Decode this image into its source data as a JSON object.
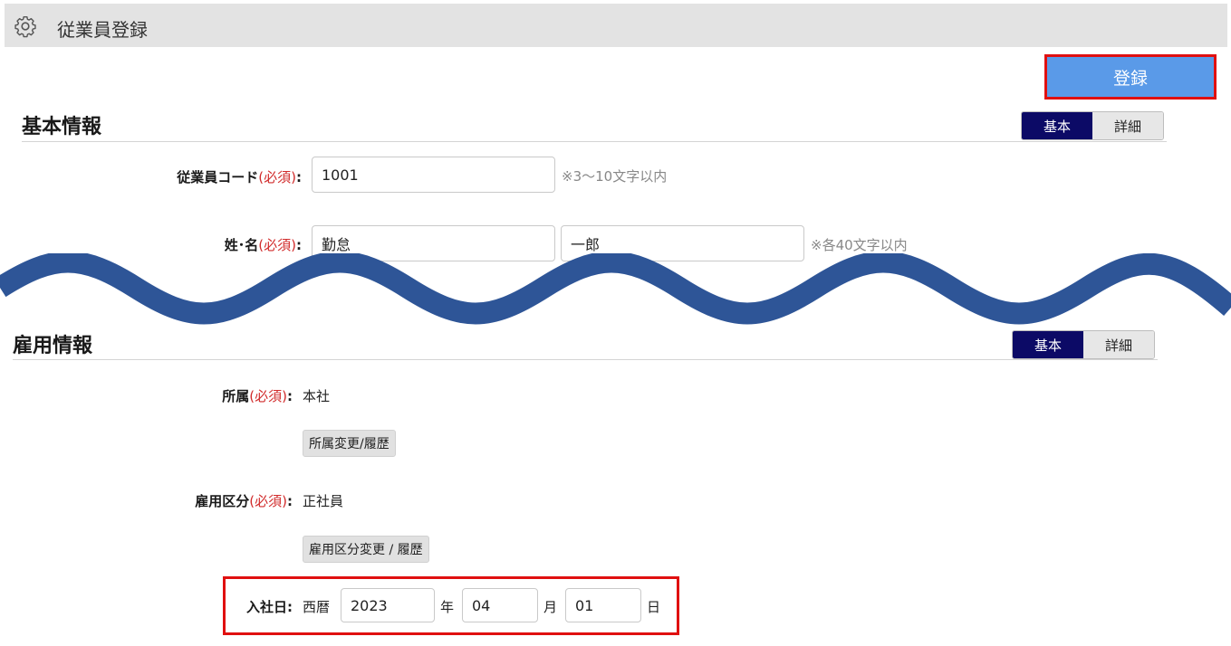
{
  "header": {
    "title": "従業員登録",
    "icon": "gear-icon"
  },
  "actions": {
    "register_label": "登録"
  },
  "basic_section": {
    "title": "基本情報",
    "toggle": {
      "basic": "基本",
      "detail": "詳細",
      "selected": "基本"
    },
    "employee_code": {
      "label": "従業員コード",
      "required": "(必須)",
      "colon": ":",
      "value": "1001",
      "hint": "※3～10文字以内"
    },
    "name": {
      "label": "姓･名",
      "required": "(必須)",
      "colon": ":",
      "last_name": "勤怠",
      "first_name": "一郎",
      "hint": "※各40文字以内"
    }
  },
  "employment_section": {
    "title": "雇用情報",
    "toggle": {
      "basic": "基本",
      "detail": "詳細",
      "selected": "基本"
    },
    "department": {
      "label": "所属",
      "required": "(必須)",
      "colon": ":",
      "value": "本社",
      "button_label": "所属変更/履歴"
    },
    "employment_type": {
      "label": "雇用区分",
      "required": "(必須)",
      "colon": ":",
      "value": "正社員",
      "button_label": "雇用区分変更 / 履歴"
    },
    "hire_date": {
      "label": "入社日",
      "colon": ":",
      "era": "西暦",
      "year": "2023",
      "year_unit": "年",
      "month": "04",
      "month_unit": "月",
      "day": "01",
      "day_unit": "日"
    }
  },
  "colors": {
    "accent": "#5a9ae8",
    "toggle_active": "#0c0a66",
    "required": "#d12b2b",
    "highlight": "#e01010",
    "wave": "#2e5597"
  }
}
